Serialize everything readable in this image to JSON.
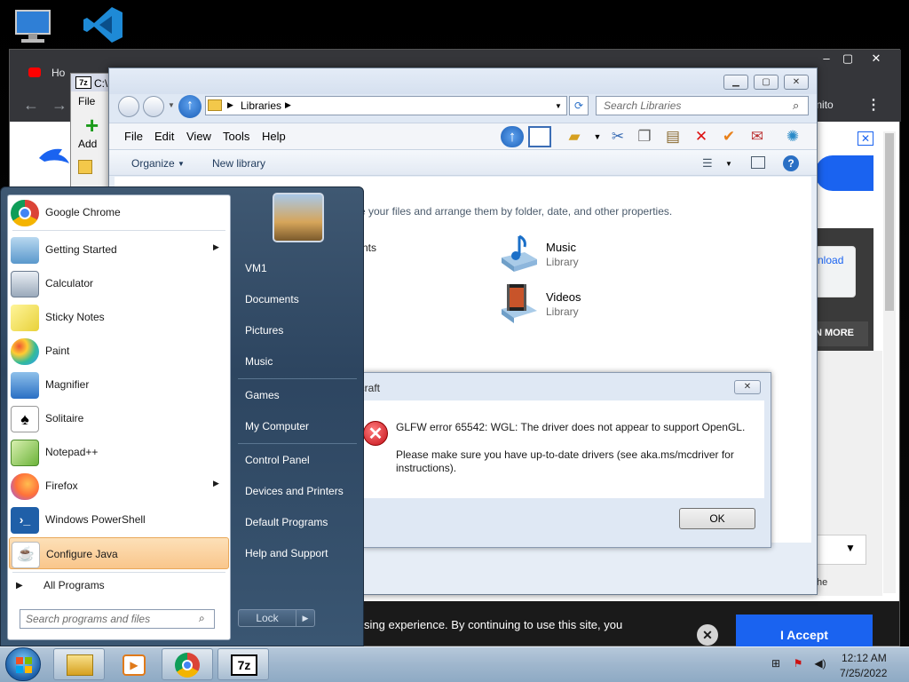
{
  "chrome": {
    "tab_label": "Ho",
    "incognito_label": "cognito",
    "ad_download_text": "nload",
    "learn_more_text": "N MORE",
    "he_text": "he",
    "cookie_text": "sing experience. By continuing to use this site, you",
    "accept_label": "I Accept"
  },
  "sevenz": {
    "title": "C:\\",
    "file_menu": "File",
    "add_label": "Add"
  },
  "explorer": {
    "breadcrumb": "Libraries",
    "search_placeholder": "Search Libraries",
    "menu": [
      "File",
      "Edit",
      "View",
      "Tools",
      "Help"
    ],
    "organize_label": "Organize",
    "new_library_label": "New library",
    "description": "e your files and arrange them by folder, date, and other properties.",
    "partial_item": "nts",
    "libraries": [
      {
        "name": "Music",
        "type": "Library"
      },
      {
        "name": "Videos",
        "type": "Library"
      }
    ]
  },
  "dialog": {
    "title": "ecraft",
    "error_line1": "GLFW error 65542: WGL: The driver does not appear to support OpenGL.",
    "error_line2": "Please make sure you have up-to-date drivers (see aka.ms/mcdriver for instructions).",
    "ok_label": "OK"
  },
  "start_menu": {
    "left_items": [
      {
        "label": "Google Chrome",
        "icon": "chrome-icon",
        "has_arrow": false
      },
      {
        "label": "Getting Started",
        "icon": "getting-started-icon",
        "has_arrow": true
      },
      {
        "label": "Calculator",
        "icon": "calculator-icon",
        "has_arrow": false
      },
      {
        "label": "Sticky Notes",
        "icon": "sticky-notes-icon",
        "has_arrow": false
      },
      {
        "label": "Paint",
        "icon": "paint-icon",
        "has_arrow": false
      },
      {
        "label": "Magnifier",
        "icon": "magnifier-icon",
        "has_arrow": false
      },
      {
        "label": "Solitaire",
        "icon": "solitaire-icon",
        "has_arrow": false
      },
      {
        "label": "Notepad++",
        "icon": "notepadpp-icon",
        "has_arrow": false
      },
      {
        "label": "Firefox",
        "icon": "firefox-icon",
        "has_arrow": true
      },
      {
        "label": "Windows PowerShell",
        "icon": "powershell-icon",
        "has_arrow": false
      },
      {
        "label": "Configure Java",
        "icon": "java-icon",
        "has_arrow": false
      }
    ],
    "all_programs": "All Programs",
    "search_placeholder": "Search programs and files",
    "right_items": [
      "VM1",
      "Documents",
      "Pictures",
      "Music",
      "Games",
      "My Computer",
      "Control Panel",
      "Devices and Printers",
      "Default Programs",
      "Help and Support"
    ],
    "lock_label": "Lock"
  },
  "taskbar": {
    "time": "12:12 AM",
    "date": "7/25/2022"
  }
}
